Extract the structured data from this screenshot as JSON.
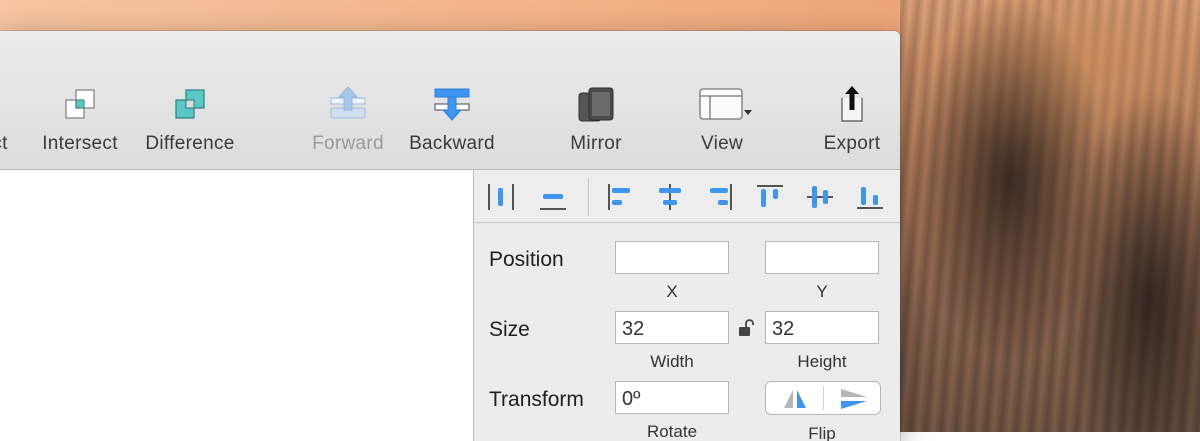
{
  "toolbar": {
    "items": [
      {
        "label": "ct",
        "icon": "subtract-icon",
        "enabled": true
      },
      {
        "label": "Intersect",
        "icon": "intersect-icon",
        "enabled": true
      },
      {
        "label": "Difference",
        "icon": "difference-icon",
        "enabled": true
      },
      {
        "label": "Forward",
        "icon": "bring-forward-icon",
        "enabled": false
      },
      {
        "label": "Backward",
        "icon": "send-backward-icon",
        "enabled": true
      },
      {
        "label": "Mirror",
        "icon": "mirror-device-icon",
        "enabled": true
      },
      {
        "label": "View",
        "icon": "view-layout-icon",
        "enabled": true
      },
      {
        "label": "Export",
        "icon": "export-icon",
        "enabled": true
      }
    ]
  },
  "inspector": {
    "align_tools": [
      "distribute-horizontal-icon",
      "distribute-vertical-icon",
      "align-left-icon",
      "align-horizontal-center-icon",
      "align-right-icon",
      "align-top-icon",
      "align-vertical-center-icon",
      "align-bottom-icon"
    ],
    "position": {
      "label": "Position",
      "x_value": "",
      "y_value": "",
      "x_label": "X",
      "y_label": "Y"
    },
    "size": {
      "label": "Size",
      "width_value": "32",
      "height_value": "32",
      "width_label": "Width",
      "height_label": "Height",
      "lock_icon": "unlocked-icon"
    },
    "transform": {
      "label": "Transform",
      "rotate_value": "0º",
      "rotate_label": "Rotate",
      "flip_label": "Flip",
      "flip_icons": [
        "flip-horizontal-icon",
        "flip-vertical-icon"
      ]
    }
  },
  "colors": {
    "accent": "#3d96f2",
    "difference_fill": "#5bc8c8"
  }
}
